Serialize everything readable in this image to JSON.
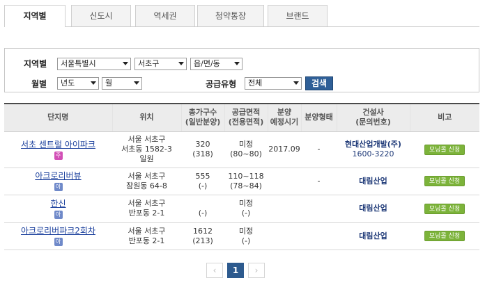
{
  "tabs": [
    {
      "label": "지역별",
      "active": true
    },
    {
      "label": "신도시",
      "active": false
    },
    {
      "label": "역세권",
      "active": false
    },
    {
      "label": "청약통장",
      "active": false
    },
    {
      "label": "브랜드",
      "active": false
    }
  ],
  "filter": {
    "region_label": "지역별",
    "city_select": "서울특별시",
    "district_select": "서초구",
    "town_select": "읍/면/동",
    "month_label": "월별",
    "year_select": "년도",
    "month_select": "월",
    "supply_label": "공급유형",
    "supply_select": "전체",
    "search_button": "검색"
  },
  "table": {
    "headers": {
      "name": "단지명",
      "location": "위치",
      "units_1": "총가구수",
      "units_2": "(일반분양)",
      "area_1": "공급면적",
      "area_2": "(전용면적)",
      "sale_1": "분양",
      "sale_2": "예정시기",
      "type": "분양형태",
      "builder_1": "건설사",
      "builder_2": "(문의번호)",
      "note": "비고"
    },
    "rows": [
      {
        "name": "서초 센트럴 아이파크",
        "badge": "주",
        "loc1": "서울 서초구",
        "loc2": "서초동 1582-3",
        "loc3": "일원",
        "units": "320",
        "units_general": "(318)",
        "area": "미정",
        "area_private": "(80~80)",
        "sale_time": "2017.09",
        "sale_type": "-",
        "builder": "현대산업개발(주)",
        "phone": "1600-3220",
        "note_btn": "모닝콜 신청"
      },
      {
        "name": "아크로리버뷰",
        "badge": "아",
        "loc1": "서울 서초구",
        "loc2": "잠원동 64-8",
        "units": "555",
        "units_general": "(-)",
        "area": "110~118",
        "area_private": "(78~84)",
        "sale_time": "",
        "sale_type": "-",
        "builder": "대림산업",
        "note_btn": "모닝콜 신청"
      },
      {
        "name": "한신",
        "badge": "아",
        "loc1": "서울 서초구",
        "loc2": "반포동 2-1",
        "units": "",
        "units_general": "(-)",
        "area": "미정",
        "area_private": "(-)",
        "sale_time": "",
        "sale_type": "",
        "builder": "대림산업",
        "note_btn": "모닝콜 신청"
      },
      {
        "name": "아크로리버파크2회차",
        "badge": "아",
        "loc1": "서울 서초구",
        "loc2": "반포동 2-1",
        "units": "1612",
        "units_general": "(213)",
        "area": "미정",
        "area_private": "(-)",
        "sale_time": "",
        "sale_type": "",
        "builder": "대림산업",
        "note_btn": "모닝콜 신청"
      }
    ]
  },
  "pagination": {
    "prev": "‹",
    "current": "1",
    "next": "›"
  }
}
